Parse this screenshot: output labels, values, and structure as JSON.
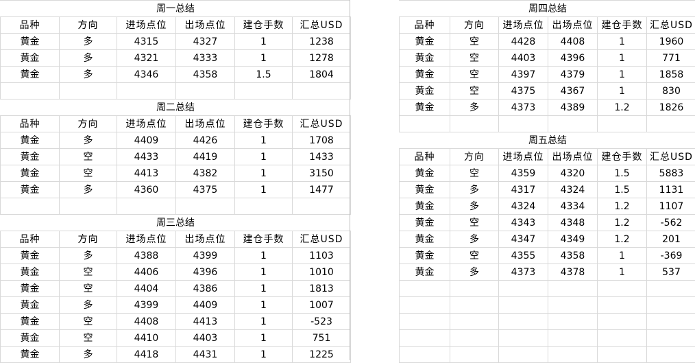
{
  "columns": [
    "品种",
    "方向",
    "进场点位",
    "出场点位",
    "建仓手数",
    "汇总USD"
  ],
  "left": [
    {
      "title": "周一总结",
      "rows": [
        [
          "黄金",
          "多",
          "4315",
          "4327",
          "1",
          "1238"
        ],
        [
          "黄金",
          "多",
          "4321",
          "4333",
          "1",
          "1278"
        ],
        [
          "黄金",
          "多",
          "4346",
          "4358",
          "1.5",
          "1804"
        ]
      ]
    },
    {
      "title": "周二总结",
      "rows": [
        [
          "黄金",
          "多",
          "4409",
          "4426",
          "1",
          "1708"
        ],
        [
          "黄金",
          "空",
          "4433",
          "4419",
          "1",
          "1433"
        ],
        [
          "黄金",
          "空",
          "4413",
          "4382",
          "1",
          "3150"
        ],
        [
          "黄金",
          "多",
          "4360",
          "4375",
          "1",
          "1477"
        ]
      ]
    },
    {
      "title": "周三总结",
      "rows": [
        [
          "黄金",
          "多",
          "4388",
          "4399",
          "1",
          "1103"
        ],
        [
          "黄金",
          "空",
          "4406",
          "4396",
          "1",
          "1010"
        ],
        [
          "黄金",
          "空",
          "4404",
          "4386",
          "1",
          "1813"
        ],
        [
          "黄金",
          "多",
          "4399",
          "4409",
          "1",
          "1007"
        ],
        [
          "黄金",
          "空",
          "4408",
          "4413",
          "1",
          "-523"
        ],
        [
          "黄金",
          "空",
          "4410",
          "4403",
          "1",
          "751"
        ],
        [
          "黄金",
          "多",
          "4418",
          "4431",
          "1",
          "1225"
        ]
      ]
    }
  ],
  "right": [
    {
      "title": "周四总结",
      "rows": [
        [
          "黄金",
          "空",
          "4428",
          "4408",
          "1",
          "1960"
        ],
        [
          "黄金",
          "空",
          "4403",
          "4396",
          "1",
          "771"
        ],
        [
          "黄金",
          "空",
          "4397",
          "4379",
          "1",
          "1858"
        ],
        [
          "黄金",
          "空",
          "4375",
          "4367",
          "1",
          "830"
        ],
        [
          "黄金",
          "多",
          "4373",
          "4389",
          "1.2",
          "1826"
        ]
      ]
    },
    {
      "title": "周五总结",
      "rows": [
        [
          "黄金",
          "空",
          "4359",
          "4320",
          "1.5",
          "5883"
        ],
        [
          "黄金",
          "多",
          "4317",
          "4324",
          "1.5",
          "1131"
        ],
        [
          "黄金",
          "多",
          "4324",
          "4334",
          "1.2",
          "1107"
        ],
        [
          "黄金",
          "空",
          "4343",
          "4348",
          "1.2",
          "-562"
        ],
        [
          "黄金",
          "多",
          "4347",
          "4349",
          "1.2",
          "201"
        ],
        [
          "黄金",
          "空",
          "4355",
          "4358",
          "1",
          "-369"
        ],
        [
          "黄金",
          "多",
          "4373",
          "4378",
          "1",
          "537"
        ]
      ]
    }
  ]
}
